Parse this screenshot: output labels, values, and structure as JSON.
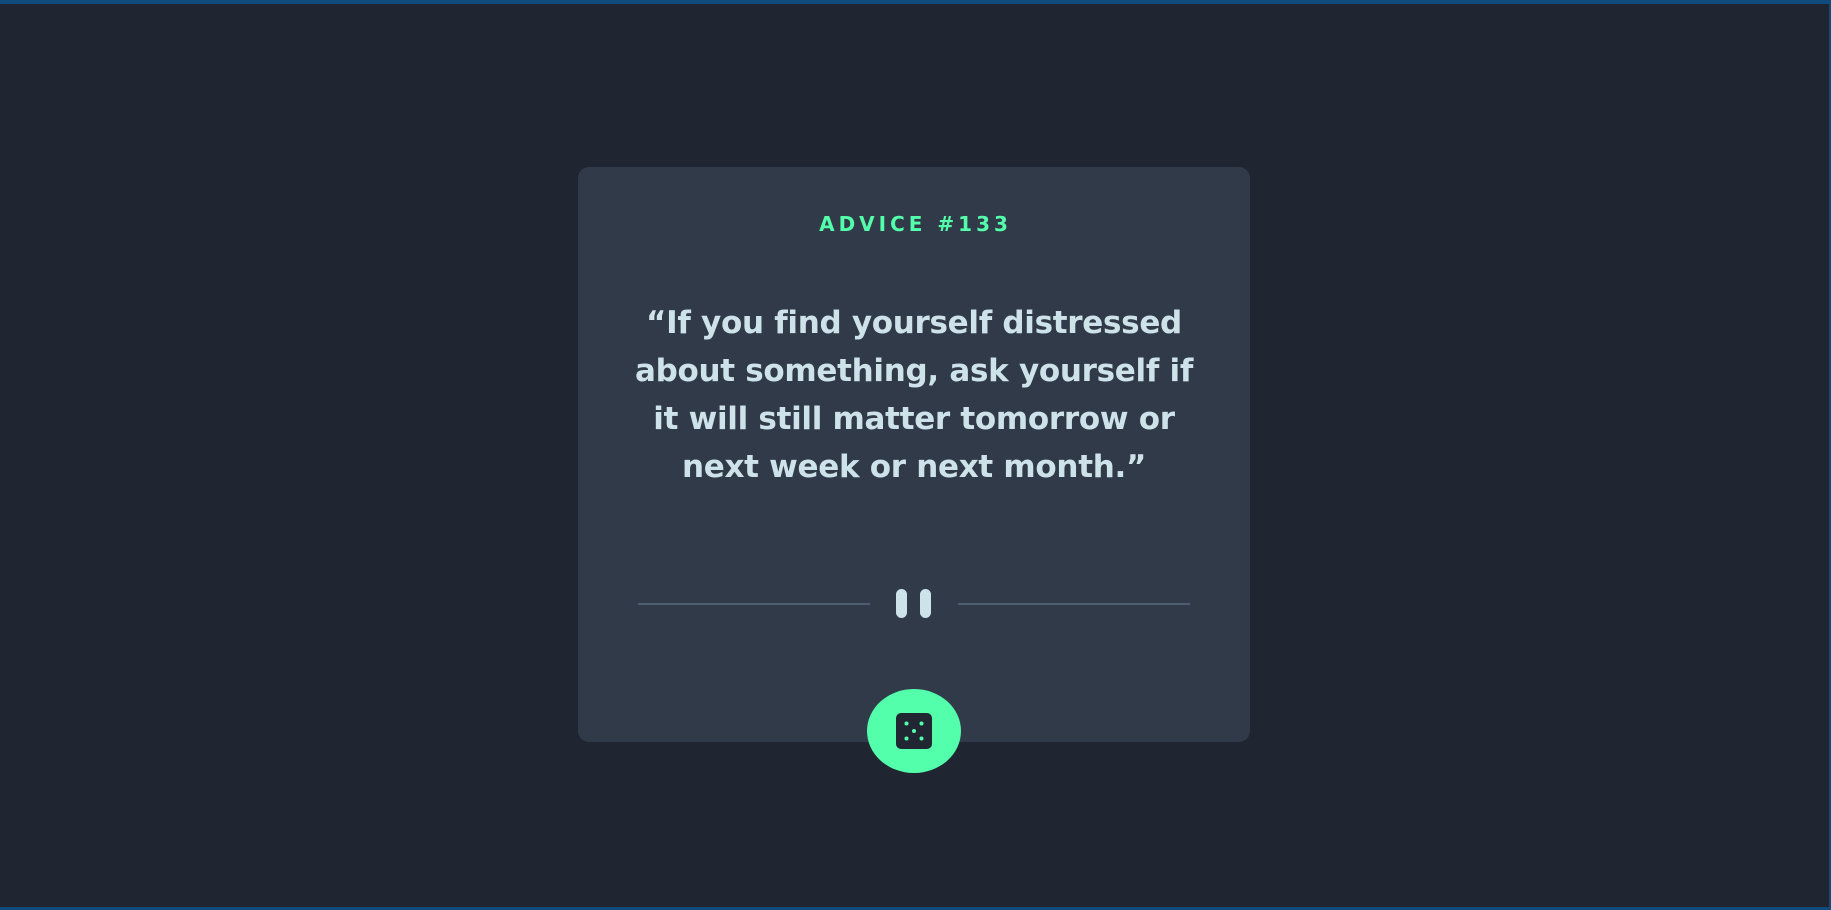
{
  "advice": {
    "id_label": "ADVICE #133",
    "quote": "“If you find yourself distressed about something, ask yourself if it will still matter tomorrow or next week or next month.”"
  },
  "divider": {
    "icon": "pause-icon"
  },
  "action": {
    "icon": "dice-icon"
  },
  "colors": {
    "background": "#1f2632",
    "card": "#313a48",
    "accent": "#53ffaa",
    "quote_text": "#cee3e9",
    "divider": "#4f5d74",
    "window_border": "#0f4c7d"
  }
}
